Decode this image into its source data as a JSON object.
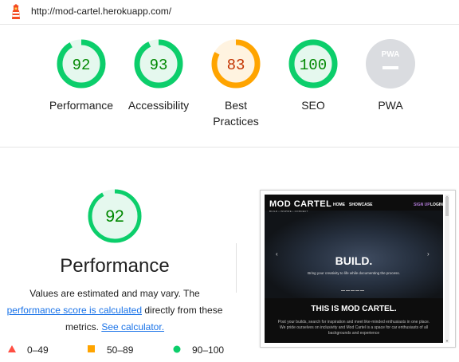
{
  "url": "http://mod-cartel.herokuapp.com/",
  "colors": {
    "pass": "#0cce6b",
    "average": "#ffa400",
    "fail": "#ff4e42",
    "pwa": "#bdbdbd"
  },
  "scores": [
    {
      "value": "92",
      "label": "Performance",
      "status": "pass",
      "fraction": 0.92
    },
    {
      "value": "93",
      "label": "Accessibility",
      "status": "pass",
      "fraction": 0.93
    },
    {
      "value": "83",
      "label": "Best Practices",
      "status": "average",
      "fraction": 0.83
    },
    {
      "value": "100",
      "label": "SEO",
      "status": "pass",
      "fraction": 1.0
    },
    {
      "value": "",
      "label": "PWA",
      "status": "pwa",
      "fraction": 0,
      "icon_text": "PWA"
    }
  ],
  "performance": {
    "score": "92",
    "fraction": 0.92,
    "title": "Performance",
    "desc_line1": "Values are estimated and may vary. The",
    "desc_link": "performance score is calculated",
    "desc_line2": " directly from these",
    "desc_line3": "metrics. ",
    "calc_link": "See calculator."
  },
  "legend": [
    {
      "icon": "triangle-icon",
      "label": "0–49"
    },
    {
      "icon": "square-icon",
      "label": "50–89"
    },
    {
      "icon": "circle-icon",
      "label": "90–100"
    }
  ],
  "screenshot": {
    "logo": "MOD CARTEL",
    "logo_sub": "BUILD • INSPIRE • CONNECT",
    "nav_home": "HOME",
    "nav_showcase": "SHOWCASE",
    "nav_signup": "SIGN UP",
    "nav_login": "LOGIN",
    "hero_title": "BUILD.",
    "hero_sub": "Bring your creativity to life while documenting the process.",
    "section_title": "THIS IS MOD CARTEL.",
    "section_text": "Post your builds, search for inspiration and meet like-minded enthusiasts in one place. We pride ourselves on inclusivity and Mod Cartel is a space for car enthusiasts of all backgrounds and experience"
  }
}
